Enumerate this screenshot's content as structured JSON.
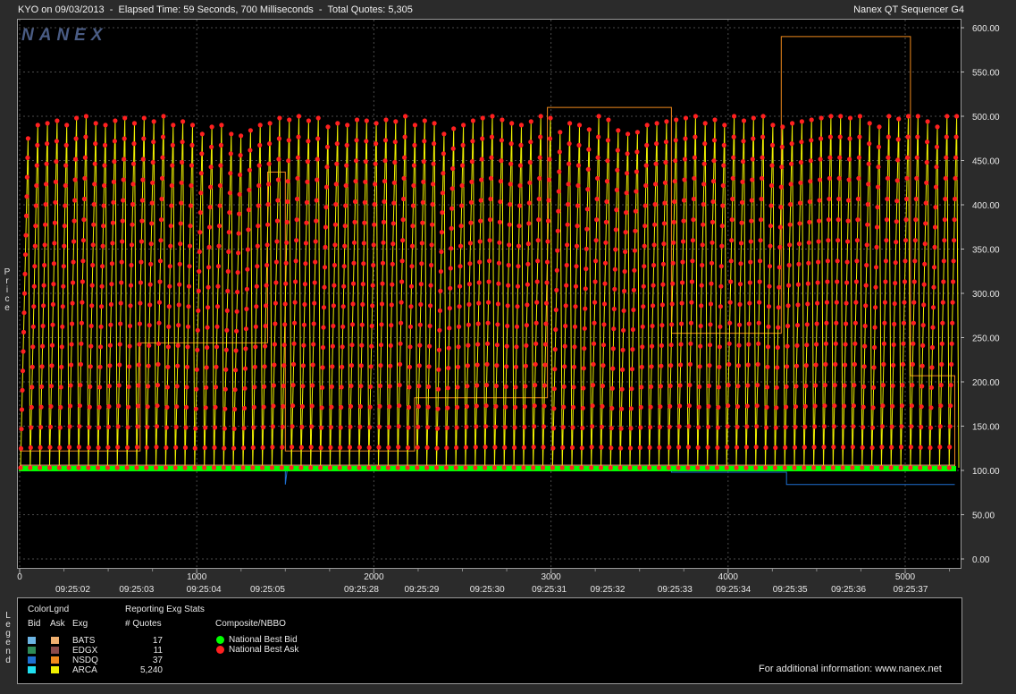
{
  "header": {
    "left": "KYO on 09/03/2013  -  Elapsed Time: 59 Seconds, 700 Milliseconds  -  Total Quotes: 5,305",
    "right": "Nanex QT Sequencer G4"
  },
  "watermark": "NANEX",
  "footer_info": "For additional information: www.nanex.net",
  "legend": {
    "side_label": "Legend",
    "color_legend_title": "ColorLgnd",
    "col_bid": "Bid",
    "col_ask": "Ask",
    "col_exg": "Exg",
    "stats_title": "Reporting Exg Stats",
    "stats_col": "# Quotes",
    "composite_title": "Composite/NBBO",
    "exchanges": [
      {
        "name": "BATS",
        "quotes": "17",
        "bid_color": "#6cb4e4",
        "ask_color": "#f0b070"
      },
      {
        "name": "EDGX",
        "quotes": "11",
        "bid_color": "#2e8b57",
        "ask_color": "#8b4a4a"
      },
      {
        "name": "NSDQ",
        "quotes": "37",
        "bid_color": "#1e6fd0",
        "ask_color": "#f08a1c"
      },
      {
        "name": "ARCA",
        "quotes": "5,240",
        "bid_color": "#20e0f0",
        "ask_color": "#f0f000"
      }
    ],
    "composite": [
      {
        "name": "National Best Bid",
        "color": "#00ff00"
      },
      {
        "name": "National Best Ask",
        "color": "#ff2020"
      }
    ]
  },
  "chart_data": {
    "type": "line",
    "title": "",
    "xlabel": "",
    "ylabel": "Price",
    "ylim": [
      -10,
      610
    ],
    "xlim": [
      0,
      5300
    ],
    "grid": true,
    "y_ticks": [
      "0.00",
      "50.00",
      "100.00",
      "150.00",
      "200.00",
      "250.00",
      "300.00",
      "350.00",
      "400.00",
      "450.00",
      "500.00",
      "550.00",
      "600.00"
    ],
    "x_ticks": [
      {
        "x": 0,
        "label": "0"
      },
      {
        "x": 1000,
        "label": "1000"
      },
      {
        "x": 2000,
        "label": "2000"
      },
      {
        "x": 3000,
        "label": "3000"
      },
      {
        "x": 4000,
        "label": "4000"
      },
      {
        "x": 5000,
        "label": "5000"
      }
    ],
    "time_labels": [
      {
        "x": 300,
        "label": "09:25:02"
      },
      {
        "x": 660,
        "label": "09:25:03"
      },
      {
        "x": 1040,
        "label": "09:25:04"
      },
      {
        "x": 1400,
        "label": "09:25:05"
      },
      {
        "x": 1930,
        "label": "09:25:28"
      },
      {
        "x": 2270,
        "label": "09:25:29"
      },
      {
        "x": 2640,
        "label": "09:25:30"
      },
      {
        "x": 2990,
        "label": "09:25:31"
      },
      {
        "x": 3320,
        "label": "09:25:32"
      },
      {
        "x": 3700,
        "label": "09:25:33"
      },
      {
        "x": 4030,
        "label": "09:25:34"
      },
      {
        "x": 4350,
        "label": "09:25:35"
      },
      {
        "x": 4680,
        "label": "09:25:36"
      },
      {
        "x": 5030,
        "label": "09:25:37"
      }
    ],
    "series": [
      {
        "name": "National Best Bid",
        "color": "#00ff00",
        "y": 102
      },
      {
        "name": "National Best Ask",
        "color": "#ff2020",
        "cycle_peaks": [
          475,
          490,
          492,
          495,
          490,
          498,
          500,
          492,
          490,
          495,
          498,
          492,
          498,
          494,
          500,
          490,
          494,
          490,
          480,
          488,
          490,
          480,
          478,
          484,
          490,
          492,
          498,
          496,
          500,
          495,
          498,
          488,
          492,
          490,
          496,
          495,
          492,
          496,
          494,
          500,
          490,
          495,
          492,
          480,
          486,
          490,
          495,
          498,
          500,
          496,
          492,
          490,
          494,
          500,
          498,
          482,
          492,
          490,
          485,
          500,
          496,
          484,
          480,
          482,
          490,
          492,
          494,
          496,
          498,
          500,
          492,
          496,
          490,
          500,
          495,
          498,
          500,
          490,
          488,
          492,
          494,
          496,
          498,
          500,
          500,
          498,
          500,
          492,
          488,
          500,
          497,
          500,
          500,
          494,
          488,
          500,
          500
        ],
        "cycle_base": 103,
        "y_range": [
          103,
          500
        ]
      },
      {
        "name": "ARCA Ask",
        "color": "#f0f000",
        "follows": "National Best Ask"
      },
      {
        "name": "NSDQ Ask",
        "color": "#f08a1c",
        "steps": [
          [
            0,
            122
          ],
          [
            680,
            122
          ],
          [
            680,
            244
          ],
          [
            1400,
            244
          ],
          [
            1400,
            437
          ],
          [
            1500,
            437
          ],
          [
            1500,
            122
          ],
          [
            2230,
            122
          ],
          [
            2230,
            182
          ],
          [
            2980,
            182
          ],
          [
            2980,
            510
          ],
          [
            3680,
            510
          ],
          [
            3680,
            255
          ],
          [
            4300,
            255
          ],
          [
            4300,
            590
          ],
          [
            5030,
            590
          ],
          [
            5030,
            207
          ],
          [
            5280,
            207
          ],
          [
            5280,
            103
          ]
        ]
      },
      {
        "name": "BATS Ask",
        "color": "#f0b070",
        "steps": [
          [
            0,
            106
          ],
          [
            5280,
            106
          ]
        ]
      },
      {
        "name": "NSDQ Bid",
        "color": "#1e6fd0",
        "steps": [
          [
            0,
            100
          ],
          [
            1500,
            100
          ],
          [
            1500,
            84
          ],
          [
            1510,
            100
          ],
          [
            3680,
            100
          ],
          [
            3680,
            98
          ],
          [
            4330,
            98
          ],
          [
            4330,
            84
          ],
          [
            5280,
            84
          ]
        ]
      },
      {
        "name": "BATS Bid",
        "color": "#6cb4e4",
        "steps": [
          [
            0,
            100
          ],
          [
            5280,
            100
          ]
        ]
      }
    ]
  }
}
